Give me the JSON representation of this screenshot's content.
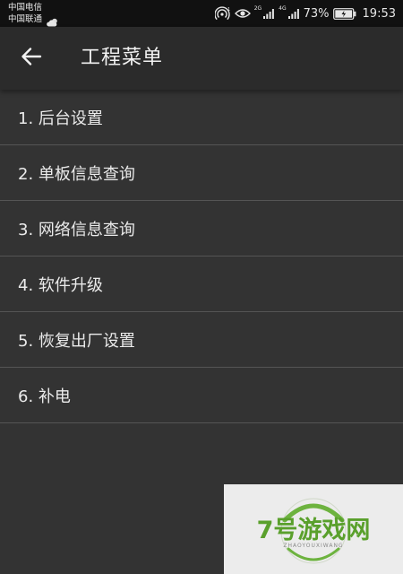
{
  "status_bar": {
    "carrier_1": "中国电信",
    "carrier_2": "中国联通",
    "net_1": "2G",
    "net_2": "4G",
    "battery_percent": "73%",
    "time": "19:53"
  },
  "app_bar": {
    "back_icon": "arrow-left-icon",
    "title": "工程菜单"
  },
  "menu": {
    "items": [
      {
        "label": "1. 后台设置"
      },
      {
        "label": "2. 单板信息查询"
      },
      {
        "label": "3. 网络信息查询"
      },
      {
        "label": "4. 软件升级"
      },
      {
        "label": "5. 恢复出厂设置"
      },
      {
        "label": "6. 补电"
      }
    ]
  },
  "watermark": {
    "brand": "7号游戏网",
    "subtitle": "ZHAOYOUXIWANG"
  },
  "colors": {
    "background": "#333333",
    "status_bar": "#111111",
    "app_bar": "#2b2b2b",
    "divider": "#555555",
    "text": "#ebebeb",
    "watermark_green": "#5aa02c"
  }
}
